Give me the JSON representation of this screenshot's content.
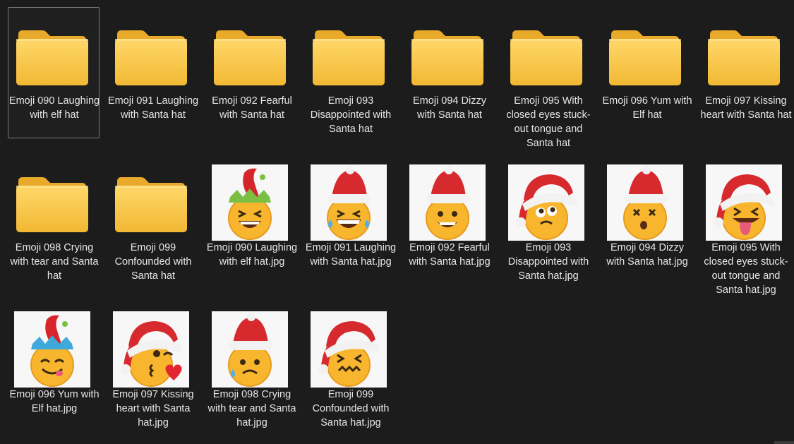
{
  "items": [
    {
      "label": "Emoji 090 Laughing with elf hat",
      "kind": "folder",
      "selected": true
    },
    {
      "label": "Emoji 091 Laughing with Santa hat",
      "kind": "folder"
    },
    {
      "label": "Emoji 092 Fearful with Santa hat",
      "kind": "folder"
    },
    {
      "label": "Emoji 093 Disappointed with Santa hat",
      "kind": "folder"
    },
    {
      "label": "Emoji 094 Dizzy with Santa hat",
      "kind": "folder"
    },
    {
      "label": "Emoji 095 With closed eyes stuck-out tongue and Santa hat",
      "kind": "folder"
    },
    {
      "label": "Emoji 096 Yum with Elf hat",
      "kind": "folder"
    },
    {
      "label": "Emoji 097 Kissing heart with Santa hat",
      "kind": "folder"
    },
    {
      "label": "Emoji 098 Crying with tear and Santa hat",
      "kind": "folder"
    },
    {
      "label": "Emoji 099 Confounded with Santa hat",
      "kind": "folder"
    },
    {
      "label": "Emoji 090 Laughing with elf hat.jpg",
      "kind": "image",
      "hat": "elf",
      "hatColor": "#d7262b",
      "crownColor": "#7bc043",
      "face": "laugh"
    },
    {
      "label": "Emoji 091 Laughing with Santa hat.jpg",
      "kind": "image",
      "hat": "santa",
      "face": "laugh-tears"
    },
    {
      "label": "Emoji 092 Fearful with Santa hat.jpg",
      "kind": "image",
      "hat": "santa",
      "face": "fearful"
    },
    {
      "label": "Emoji 093 Disappointed with Santa hat.jpg",
      "kind": "image",
      "hat": "santa-big",
      "face": "disappointed"
    },
    {
      "label": "Emoji 094 Dizzy with Santa hat.jpg",
      "kind": "image",
      "hat": "santa",
      "face": "dizzy"
    },
    {
      "label": "Emoji 095 With closed eyes stuck-out tongue and Santa hat.jpg",
      "kind": "image",
      "hat": "santa-big",
      "face": "tongue"
    },
    {
      "label": "Emoji 096 Yum with Elf hat.jpg",
      "kind": "image",
      "hat": "elf",
      "hatColor": "#d7262b",
      "crownColor": "#3fa9dc",
      "face": "yum"
    },
    {
      "label": "Emoji 097 Kissing heart with Santa hat.jpg",
      "kind": "image",
      "hat": "santa-big",
      "face": "kiss"
    },
    {
      "label": "Emoji 098 Crying with tear and Santa hat.jpg",
      "kind": "image",
      "hat": "santa",
      "face": "crying"
    },
    {
      "label": "Emoji 099 Confounded with Santa hat.jpg",
      "kind": "image",
      "hat": "santa-big",
      "face": "confounded"
    }
  ],
  "icons": {
    "folder": "folder-icon",
    "image": "image-thumbnail"
  },
  "colors": {
    "background": "#1c1c1c",
    "text": "#e6e6e6",
    "folder": "#f6c94a",
    "selection": "#7a7a7a",
    "face": "#f8b62f",
    "hat": "#d72a2f"
  }
}
